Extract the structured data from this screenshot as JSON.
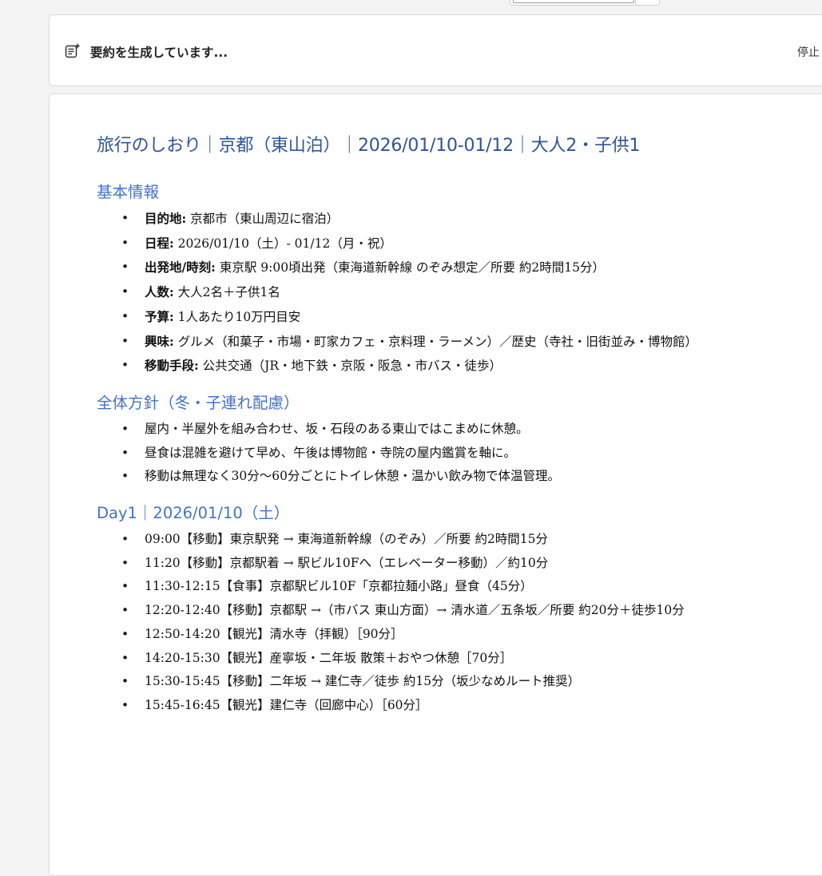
{
  "summary_bar": {
    "status_text": "要約を生成しています...",
    "stop_label": "停止",
    "icon": "ai-summary-icon"
  },
  "document": {
    "title": "旅行のしおり｜京都（東山泊）｜2026/01/10-01/12｜大人2・子供1",
    "sections": [
      {
        "heading": "基本情報",
        "items": [
          {
            "label": "目的地:",
            "text": " 京都市（東山周辺に宿泊）"
          },
          {
            "label": "日程:",
            "text": " 2026/01/10（土）- 01/12（月・祝）"
          },
          {
            "label": "出発地/時刻:",
            "text": " 東京駅 9:00頃出発（東海道新幹線 のぞみ想定／所要 約2時間15分）"
          },
          {
            "label": "人数:",
            "text": " 大人2名＋子供1名"
          },
          {
            "label": "予算:",
            "text": " 1人あたり10万円目安"
          },
          {
            "label": "興味:",
            "text": " グルメ（和菓子・市場・町家カフェ・京料理・ラーメン）／歴史（寺社・旧街並み・博物館）"
          },
          {
            "label": "移動手段:",
            "text": " 公共交通（JR・地下鉄・京阪・阪急・市バス・徒歩）"
          }
        ]
      },
      {
        "heading": "全体方針（冬・子連れ配慮）",
        "items": [
          {
            "label": "",
            "text": "屋内・半屋外を組み合わせ、坂・石段のある東山ではこまめに休憩。"
          },
          {
            "label": "",
            "text": "昼食は混雑を避けて早め、午後は博物館・寺院の屋内鑑賞を軸に。"
          },
          {
            "label": "",
            "text": "移動は無理なく30分〜60分ごとにトイレ休憩・温かい飲み物で体温管理。"
          }
        ]
      },
      {
        "heading": "Day1｜2026/01/10（土）",
        "items": [
          {
            "label": "",
            "text": "09:00【移動】東京駅発 → 東海道新幹線（のぞみ）／所要 約2時間15分"
          },
          {
            "label": "",
            "text": "11:20【移動】京都駅着 → 駅ビル10Fへ（エレベーター移動）／約10分"
          },
          {
            "label": "",
            "text": "11:30-12:15【食事】京都駅ビル10F「京都拉麺小路」昼食（45分）"
          },
          {
            "label": "",
            "text": "12:20-12:40【移動】京都駅 →（市バス 東山方面）→ 清水道／五条坂／所要 約20分＋徒歩10分"
          },
          {
            "label": "",
            "text": "12:50-14:20【観光】清水寺（拝観）［90分］"
          },
          {
            "label": "",
            "text": "14:20-15:30【観光】産寧坂・二年坂 散策＋おやつ休憩［70分］"
          },
          {
            "label": "",
            "text": "15:30-15:45【移動】二年坂 → 建仁寺／徒歩 約15分（坂少なめルート推奨）"
          },
          {
            "label": "",
            "text": "15:45-16:45【観光】建仁寺（回廊中心）［60分］"
          }
        ]
      }
    ]
  }
}
